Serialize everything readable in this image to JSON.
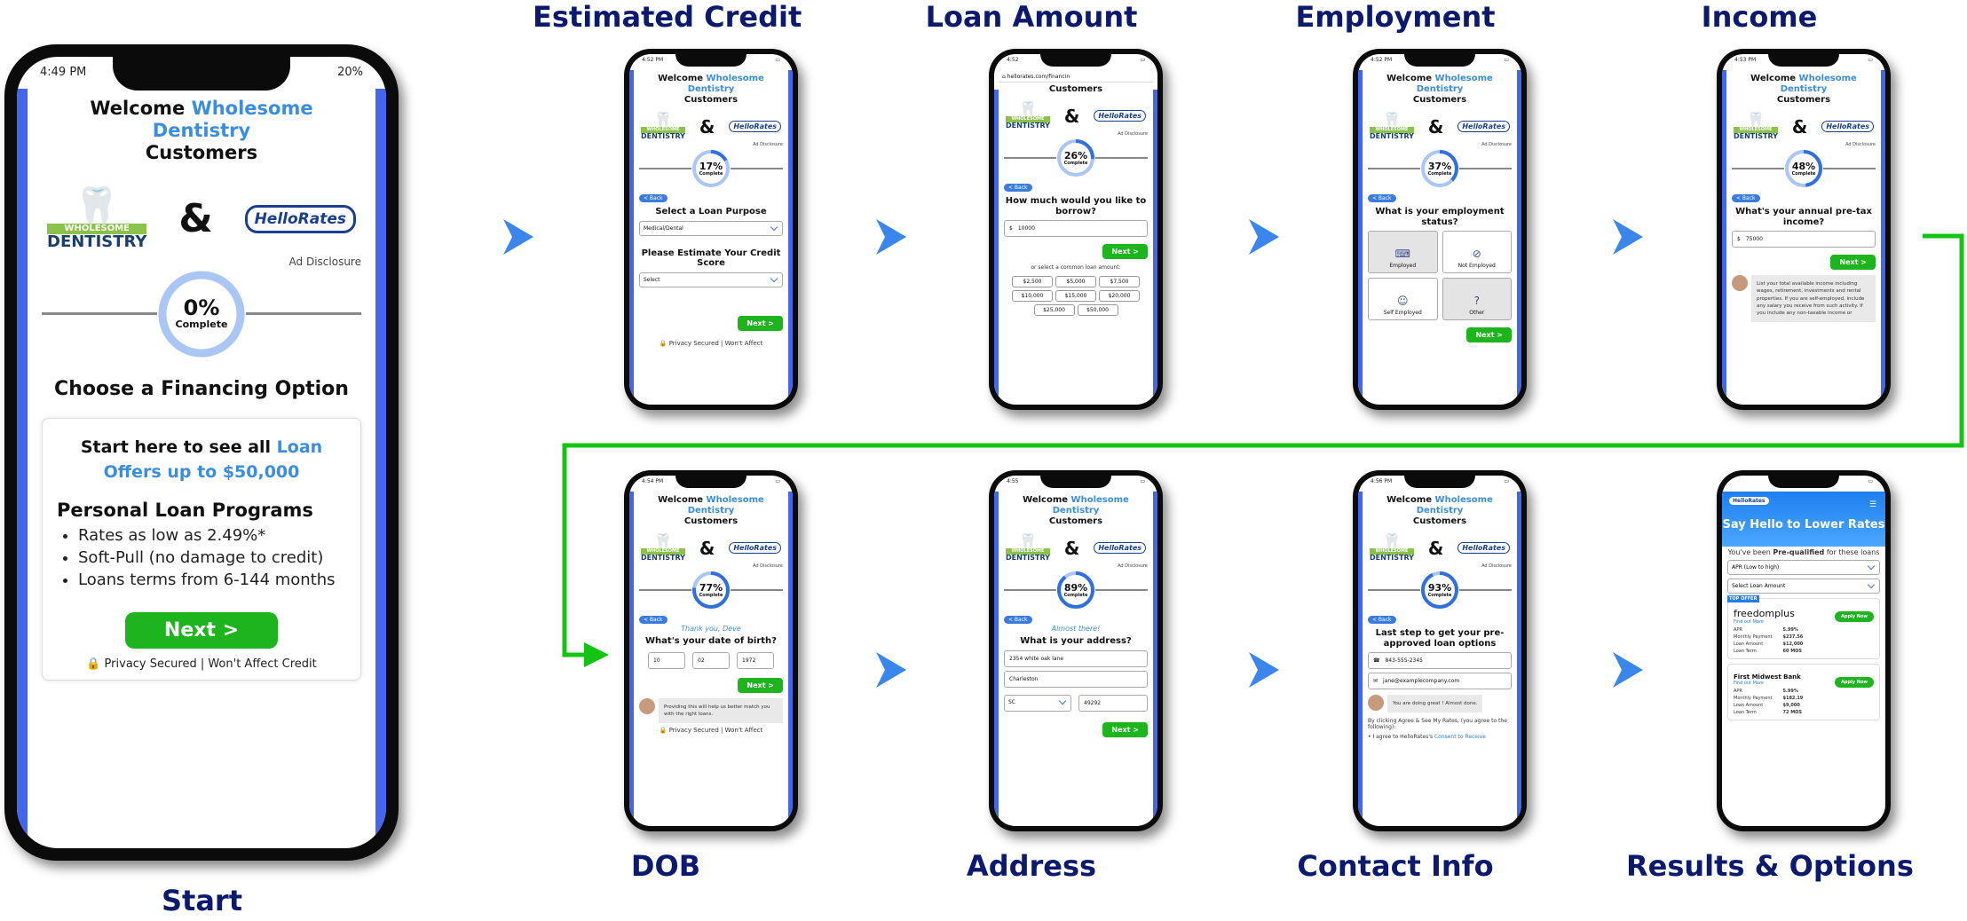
{
  "start_label": "Start",
  "arrow_color": "#3a86ec",
  "connector_color": "#14c414",
  "common": {
    "welcome_pre": "Welcome",
    "welcome_brand": "Wholesome Dentistry",
    "welcome_post": "Customers",
    "dent_top": "WHOLESOME",
    "dent_bottom": "DENTISTRY",
    "amp": "&",
    "hellorates": "HelloRates",
    "ad_disclosure": "Ad Disclosure",
    "complete": "Complete",
    "back": "< Back",
    "next": "Next >",
    "privacy": "🔒 Privacy Secured | Won't Affect"
  },
  "start": {
    "time": "4:49 PM",
    "battery": "20%",
    "progress": "0%",
    "progress_value": 0,
    "title": "Choose a Financing Option",
    "offer_pre": "Start here to see all",
    "offer_blue": "Loan Offers up to $50,000",
    "programs_title": "Personal Loan Programs",
    "bullets": [
      "Rates as low as 2.49%*",
      "Soft-Pull (no damage to credit)",
      "Loans terms from 6-144 months"
    ],
    "next": "Next >",
    "privacy": "🔒 Privacy Secured | Won't Affect Credit"
  },
  "steps": {
    "credit": {
      "label": "Estimated Credit",
      "time": "4:52 PM",
      "progress": "17%",
      "progress_value": 17,
      "q1": "Select a Loan Purpose",
      "purpose": "Medical/Dental",
      "q2": "Please Estimate Your Credit Score",
      "score": "Select",
      "next": "Next >",
      "privacy": "🔒 Privacy Secured | Won't Affect"
    },
    "loan": {
      "label": "Loan Amount",
      "time": "4:52",
      "url": "hellorates.com/financin",
      "progress": "26%",
      "progress_value": 26,
      "q": "How much would you like to borrow?",
      "currency": "$",
      "amount": "10000",
      "next": "Next >",
      "common_label": "or select a common loan amount:",
      "chips": [
        "$2,500",
        "$5,000",
        "$7,500",
        "$10,000",
        "$15,000",
        "$20,000",
        "$25,000",
        "$50,000"
      ]
    },
    "employment": {
      "label": "Employment",
      "time": "4:52 PM",
      "progress": "37%",
      "progress_value": 37,
      "q": "What is your employment status?",
      "options": [
        "Employed",
        "Not Employed",
        "Self Employed",
        "Other"
      ],
      "next": "Next >"
    },
    "income": {
      "label": "Income",
      "time": "4:53 PM",
      "progress": "48%",
      "progress_value": 48,
      "q": "What's your annual pre-tax income?",
      "currency": "$",
      "amount": "75000",
      "next": "Next >",
      "tip": "List your total available income including wages, retirement, investments and rental properties. If you are self-employed, include any salary you receive from such activity. If you include any non-taxable income or"
    },
    "dob": {
      "label": "DOB",
      "time": "4:54 PM",
      "progress": "77%",
      "progress_value": 77,
      "thanks": "Thank you, Deve",
      "q": "What's your date of birth?",
      "month": "10",
      "day": "02",
      "year": "1972",
      "next": "Next >",
      "tip": "Providing this will help us better match you with the right loans.",
      "privacy": "🔒 Privacy Secured | Won't Affect"
    },
    "address": {
      "label": "Address",
      "time": "4:55",
      "progress": "89%",
      "progress_value": 89,
      "almost": "Almost there!",
      "q": "What is your address?",
      "street": "2354 white oak lane",
      "city": "Charleston",
      "state": "SC",
      "zip": "49292",
      "next": "Next >"
    },
    "contact": {
      "label": "Contact Info",
      "time": "4:56 PM",
      "progress": "93%",
      "progress_value": 93,
      "q": "Last step to get your pre-approved loan options",
      "phone": "843-555-2345",
      "email": "jane@examplecompany.com",
      "tip": "You are doing great ! Almost done.",
      "agree": "By clicking Agree & See My Rates, (you agree to the following):",
      "consent_pre": "• I agree to HelloRates's",
      "consent_link": "Consent to Receive"
    },
    "results": {
      "label": "Results & Options",
      "logo": "HelloRates",
      "headline": "Say Hello to Lower Rates",
      "prequal_pre": "You've been",
      "prequal_bold": "Pre-qualified",
      "prequal_post": "for these loans",
      "sort": "APR (Low to high)",
      "loan_amount": "Select Loan Amount",
      "top_offer": "TOP OFFER",
      "apply": "Apply Now",
      "find_more": "Find out More",
      "lender1": {
        "name": "freedomplus",
        "rows": [
          [
            "APR",
            "5.99%"
          ],
          [
            "Monthly Payment",
            "$237.56"
          ],
          [
            "Loan Amount",
            "$12,000"
          ],
          [
            "Loan Term",
            "60 MOS"
          ]
        ]
      },
      "lender2": {
        "name": "First Midwest Bank",
        "rows": [
          [
            "APR",
            "5.99%"
          ],
          [
            "Monthly Payment",
            "$182.19"
          ],
          [
            "Loan Amount",
            "$9,000"
          ],
          [
            "Loan Term",
            "72 MOS"
          ]
        ]
      }
    }
  }
}
